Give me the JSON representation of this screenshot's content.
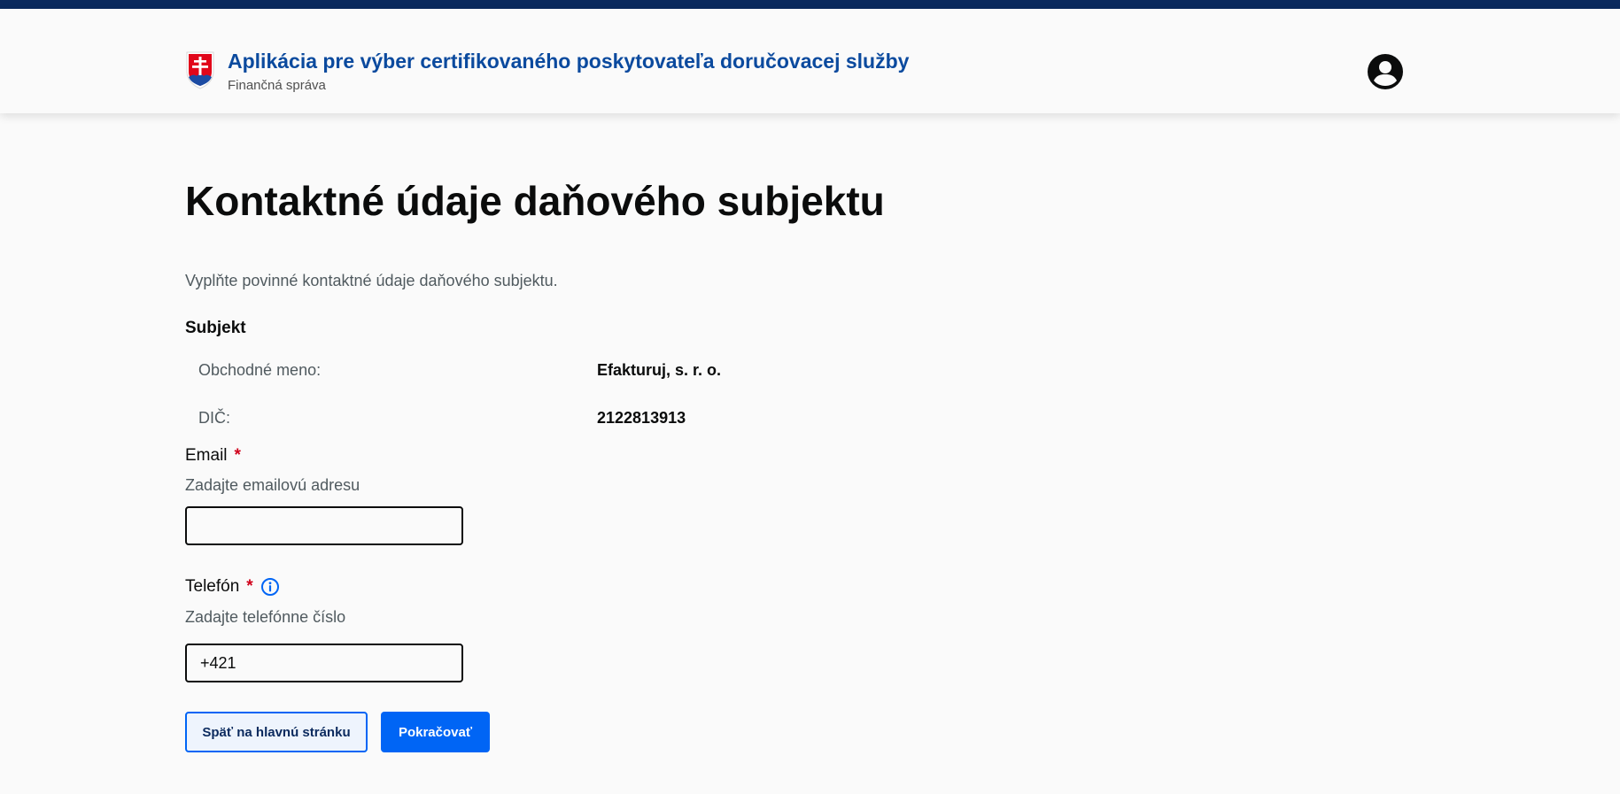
{
  "header": {
    "app_title": "Aplikácia pre výber certifikovaného poskytovateľa doručovacej služby",
    "app_subtitle": "Finančná správa",
    "coat_icon": "slovak-coat-of-arms-icon",
    "profile_icon": "account-circle-icon"
  },
  "page": {
    "title": "Kontaktné údaje daňového subjektu",
    "intro": "Vyplňte povinné kontaktné údaje daňového subjektu."
  },
  "subject": {
    "heading": "Subjekt",
    "rows": [
      {
        "key": "Obchodné meno:",
        "value": "Efakturuj, s. r. o."
      },
      {
        "key": "DIČ:",
        "value": "2122813913"
      }
    ]
  },
  "form": {
    "email": {
      "label": "Email",
      "required_mark": "*",
      "hint": "Zadajte emailovú adresu",
      "value": ""
    },
    "phone": {
      "label": "Telefón",
      "required_mark": "*",
      "hint": "Zadajte telefónne číslo",
      "value": "+421",
      "info_icon": "info-circle-icon"
    }
  },
  "actions": {
    "back_label": "Späť na hlavnú stránku",
    "continue_label": "Pokračovať"
  },
  "colors": {
    "top_bar": "#0b2a5e",
    "brand_title": "#0b4a9e",
    "primary": "#0065f5",
    "required": "#d0021b"
  }
}
